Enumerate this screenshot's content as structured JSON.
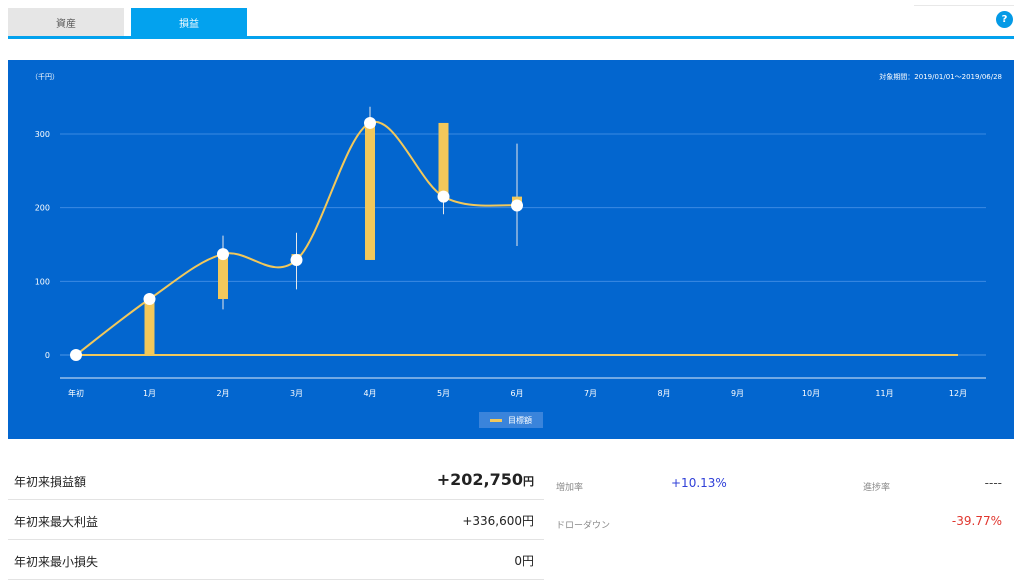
{
  "tabs": [
    {
      "label": "資産"
    },
    {
      "label": "損益"
    }
  ],
  "help_label": "?",
  "chart": {
    "unit": "（千円）",
    "period": "対象期間：2019/01/01～2019/06/28",
    "legend": "目標額"
  },
  "chart_data": {
    "type": "line",
    "categories": [
      "年初",
      "1月",
      "2月",
      "3月",
      "4月",
      "5月",
      "6月",
      "7月",
      "8月",
      "9月",
      "10月",
      "11月",
      "12月"
    ],
    "yticks": [
      0,
      100,
      200,
      300
    ],
    "ylim": [
      -30,
      340
    ],
    "grid": true,
    "legend_position": "bottom",
    "target_line": [
      0,
      0,
      0,
      0,
      0,
      0,
      0,
      0,
      0,
      0,
      0,
      0,
      0
    ],
    "line_values": [
      0,
      76,
      137,
      129,
      315,
      215,
      203
    ],
    "candles": [
      {
        "open": 0,
        "close": 76,
        "high": 76,
        "low": 0
      },
      {
        "open": 76,
        "close": 137,
        "high": 162,
        "low": 62
      },
      {
        "open": 129,
        "close": 137,
        "high": 166,
        "low": 89
      },
      {
        "open": 129,
        "close": 315,
        "high": 337,
        "low": 129
      },
      {
        "open": 315,
        "close": 215,
        "high": 315,
        "low": 191
      },
      {
        "open": 215,
        "close": 203,
        "high": 287,
        "low": 148
      }
    ],
    "colors": {
      "line": "#f2c85b",
      "bar": "#f2c85b",
      "wick": "#e8e8e8",
      "point": "#ffffff"
    }
  },
  "stats": [
    {
      "label": "年初来損益額",
      "value": "+202,750",
      "suffix": "円"
    },
    {
      "label": "年初来最大利益",
      "value": "+336,600円"
    },
    {
      "label": "年初来最小損失",
      "value": "0円"
    }
  ],
  "metrics": [
    {
      "label": "増加率",
      "value": "+10.13%"
    },
    {
      "label": "進捗率",
      "value": "----"
    },
    {
      "label": "ドローダウン",
      "value": "-39.77%"
    }
  ]
}
